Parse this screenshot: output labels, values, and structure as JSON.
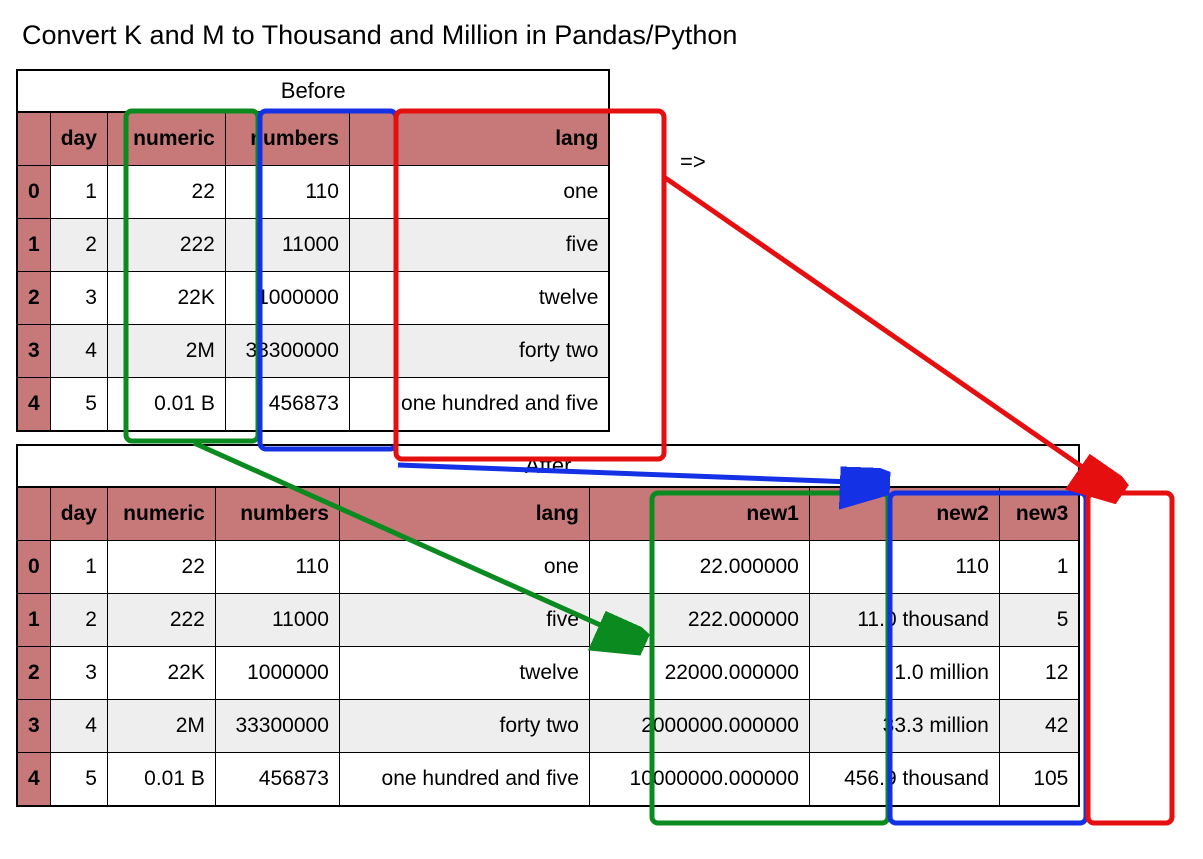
{
  "title": "Convert K and M to Thousand and Million in Pandas/Python",
  "arrow_symbol": "=>",
  "before": {
    "caption": "Before",
    "columns": [
      "day",
      "numeric",
      "numbers",
      "lang"
    ],
    "index": [
      "0",
      "1",
      "2",
      "3",
      "4"
    ],
    "rows": [
      {
        "day": "1",
        "numeric": "22",
        "numbers": "110",
        "lang": "one"
      },
      {
        "day": "2",
        "numeric": "222",
        "numbers": "11000",
        "lang": "five"
      },
      {
        "day": "3",
        "numeric": "22K",
        "numbers": "1000000",
        "lang": "twelve"
      },
      {
        "day": "4",
        "numeric": "2M",
        "numbers": "33300000",
        "lang": "forty two"
      },
      {
        "day": "5",
        "numeric": "0.01 B",
        "numbers": "456873",
        "lang": "one hundred and five"
      }
    ]
  },
  "after": {
    "caption": "After",
    "columns": [
      "day",
      "numeric",
      "numbers",
      "lang",
      "new1",
      "new2",
      "new3"
    ],
    "index": [
      "0",
      "1",
      "2",
      "3",
      "4"
    ],
    "rows": [
      {
        "day": "1",
        "numeric": "22",
        "numbers": "110",
        "lang": "one",
        "new1": "22.000000",
        "new2": "110",
        "new3": "1"
      },
      {
        "day": "2",
        "numeric": "222",
        "numbers": "11000",
        "lang": "five",
        "new1": "222.000000",
        "new2": "11.0 thousand",
        "new3": "5"
      },
      {
        "day": "3",
        "numeric": "22K",
        "numbers": "1000000",
        "lang": "twelve",
        "new1": "22000.000000",
        "new2": "1.0 million",
        "new3": "12"
      },
      {
        "day": "4",
        "numeric": "2M",
        "numbers": "33300000",
        "lang": "forty two",
        "new1": "2000000.000000",
        "new2": "33.3 million",
        "new3": "42"
      },
      {
        "day": "5",
        "numeric": "0.01 B",
        "numbers": "456873",
        "lang": "one hundred and five",
        "new1": "10000000.000000",
        "new2": "456.9 thousand",
        "new3": "105"
      }
    ]
  },
  "highlight_colors": {
    "numeric_to_new1": "#0b8a1f",
    "numbers_to_new2": "#1431e6",
    "lang_to_new3": "#e60f0f"
  }
}
